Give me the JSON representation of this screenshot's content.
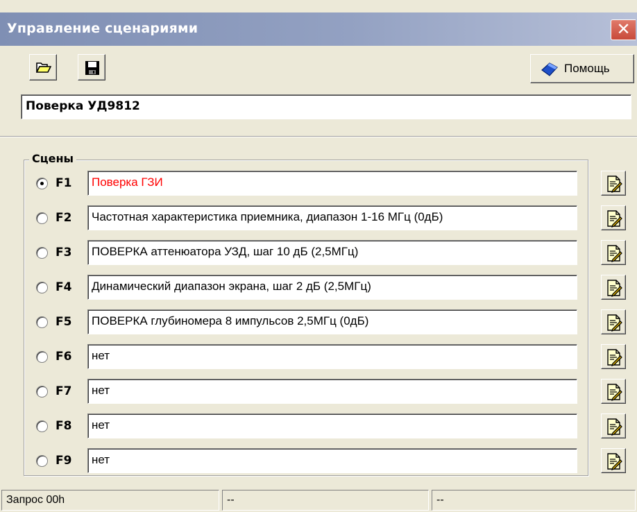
{
  "window": {
    "title": "Управление сценариями",
    "close_glyph": "✕"
  },
  "toolbar": {
    "open_icon": "folder-open-icon",
    "save_icon": "floppy-save-icon",
    "help_label": "Помощь",
    "help_icon": "help-book-icon"
  },
  "scenario": {
    "name": "Поверка УД9812"
  },
  "scenes": {
    "group_label": "Сцены",
    "selected_index": 0,
    "active_color": "#ff0000",
    "items": [
      {
        "key": "F1",
        "value": "Поверка ГЗИ"
      },
      {
        "key": "F2",
        "value": "Частотная характеристика приемника, диапазон 1-16 МГц (0дБ)"
      },
      {
        "key": "F3",
        "value": "ПОВЕРКА аттенюатора УЗД, шаг 10 дБ  (2,5МГц)"
      },
      {
        "key": "F4",
        "value": "Динамический диапазон экрана, шаг 2 дБ (2,5МГц)"
      },
      {
        "key": "F5",
        "value": "ПОВЕРКА глубиномера 8 импульсов 2,5МГц (0дБ)"
      },
      {
        "key": "F6",
        "value": "нет"
      },
      {
        "key": "F7",
        "value": "нет"
      },
      {
        "key": "F8",
        "value": "нет"
      },
      {
        "key": "F9",
        "value": "нет"
      }
    ],
    "edit_icon": "edit-scene-icon"
  },
  "statusbar": {
    "cells": [
      "Запрос 00h",
      "--",
      "--"
    ]
  }
}
